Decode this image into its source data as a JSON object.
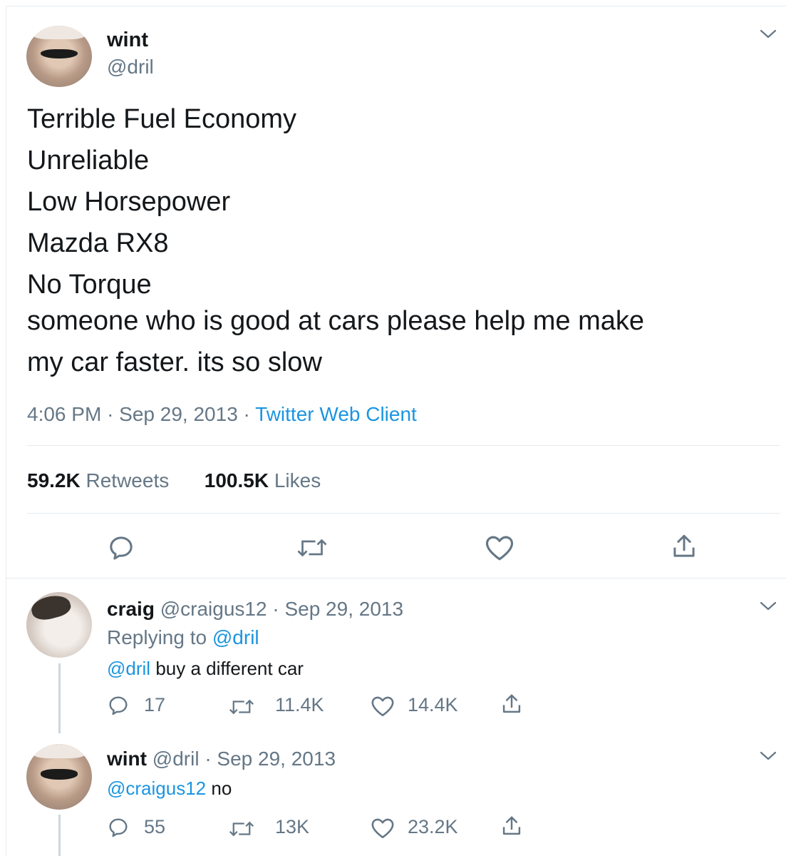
{
  "main_tweet": {
    "author_name": "wint",
    "author_handle": "@dril",
    "lines": [
      "Terrible Fuel Economy",
      "Unreliable",
      "Low Horsepower",
      "Mazda RX8",
      "No Torque",
      "someone who is good at cars please help me make",
      "my car faster. its so slow"
    ],
    "time": "4:06 PM",
    "sep": "·",
    "date": "Sep 29, 2013",
    "client": "Twitter Web Client",
    "retweets_count": "59.2K",
    "retweets_label": "Retweets",
    "likes_count": "100.5K",
    "likes_label": "Likes"
  },
  "replies": [
    {
      "author_name": "craig",
      "author_handle": "@craigus12",
      "date_text": "· Sep 29, 2013",
      "replying_prefix": "Replying to",
      "replying_handle": "@dril",
      "mention": "@dril",
      "text": "buy a different car",
      "reply_count": "17",
      "retweet_count": "11.4K",
      "like_count": "14.4K"
    },
    {
      "author_name": "wint",
      "author_handle": "@dril",
      "date_text": "· Sep 29, 2013",
      "mention": "@craigus12",
      "text": "no",
      "reply_count": "55",
      "retweet_count": "13K",
      "like_count": "23.2K"
    }
  ],
  "icons": {
    "reply": "reply-icon",
    "retweet": "retweet-icon",
    "like": "heart-icon",
    "share": "share-icon",
    "menu": "chevron-down-icon"
  },
  "colors": {
    "link": "#1b95e0",
    "muted": "#657786",
    "text": "#14171a",
    "divider": "#e6ecf0"
  }
}
